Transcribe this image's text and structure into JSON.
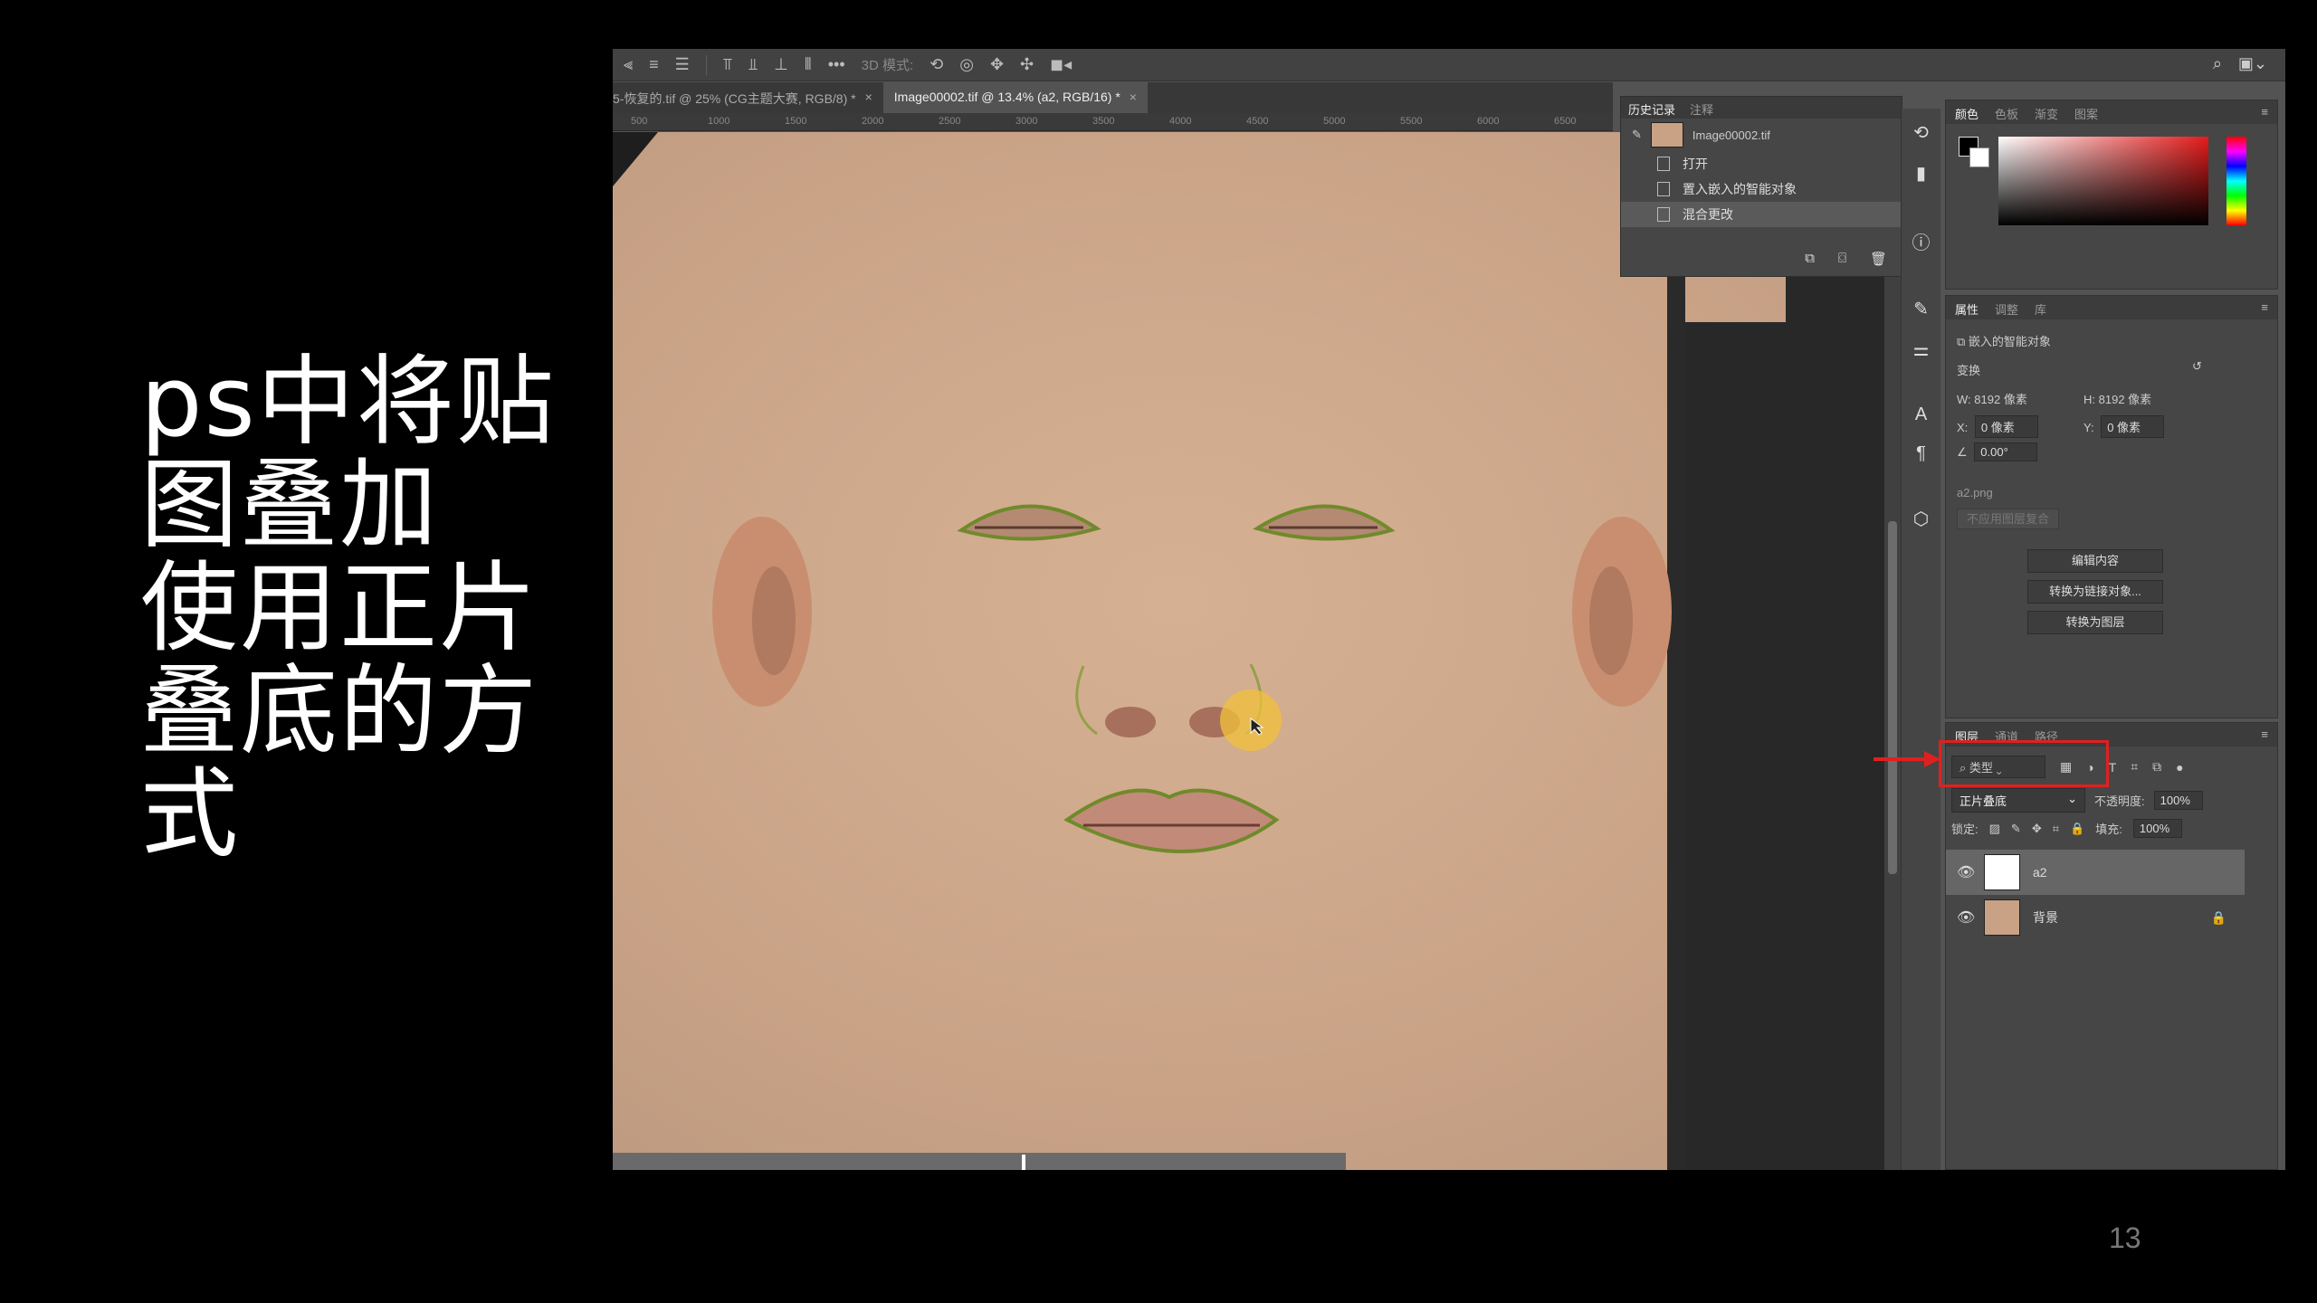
{
  "slide": {
    "title_lines": [
      "ps中将贴",
      "图叠加",
      "使用正片",
      "叠底的方",
      "式"
    ],
    "page_number": "13"
  },
  "photoshop": {
    "options_bar": {
      "mode_label": "3D 模式:",
      "more": "•••"
    },
    "doc_tabs": [
      {
        "label": "5-恢复的.tif @ 25% (CG主题大赛, RGB/8) *",
        "close": "×"
      },
      {
        "label": "Image00002.tif @ 13.4% (a2, RGB/16) *",
        "close": "×"
      }
    ],
    "ruler_ticks": [
      "500",
      "1000",
      "1500",
      "2000",
      "2500",
      "3000",
      "3500",
      "4000",
      "4500",
      "5000",
      "5500",
      "6000",
      "6500"
    ],
    "history": {
      "tabs": [
        "历史记录",
        "注释"
      ],
      "snapshot": "Image00002.tif",
      "items": [
        "打开",
        "置入嵌入的智能对象",
        "混合更改"
      ],
      "selected_index": 2
    },
    "colors_panel": {
      "tabs": [
        "颜色",
        "色板",
        "渐变",
        "图案"
      ],
      "foreground": "#000000",
      "background": "#ffffff",
      "hue_color": "#e51b1b"
    },
    "properties": {
      "tabs": [
        "属性",
        "调整",
        "库"
      ],
      "object_type": "嵌入的智能对象",
      "transform_label": "变换",
      "w_label": "W:",
      "w_value": "8192 像素",
      "h_label": "H:",
      "h_value": "8192 像素",
      "x_label": "X:",
      "x_value": "0 像素",
      "y_label": "Y:",
      "y_value": "0 像素",
      "angle_value": "0.00°",
      "source_file": "a2.png",
      "comp_placeholder": "不应用图层复合",
      "buttons": [
        "编辑内容",
        "转换为链接对象...",
        "转换为图层"
      ]
    },
    "layers": {
      "tabs": [
        "图层",
        "通道",
        "路径"
      ],
      "kind_filter": "类型",
      "blend_mode": "正片叠底",
      "opacity_label": "不透明度:",
      "opacity_value": "100%",
      "lock_label": "锁定:",
      "fill_label": "填充:",
      "fill_value": "100%",
      "items": [
        {
          "name": "a2",
          "selected": true,
          "locked": false
        },
        {
          "name": "背景",
          "selected": false,
          "locked": true
        }
      ]
    },
    "annotation_color": "#e02020"
  }
}
